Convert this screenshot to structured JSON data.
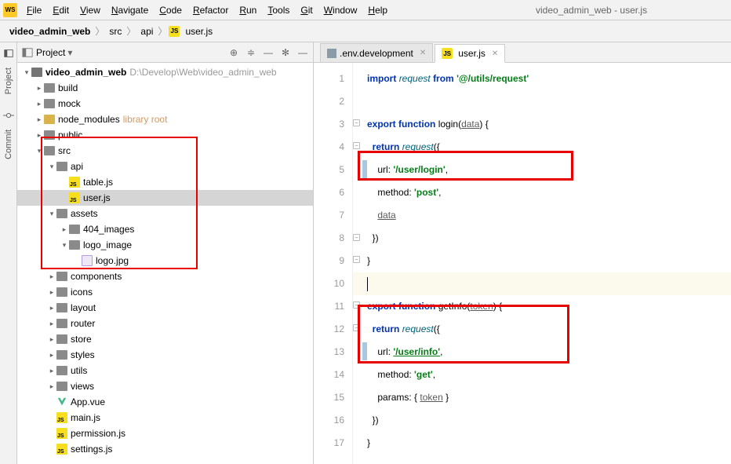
{
  "window": {
    "app": "WS",
    "title": "video_admin_web - user.js"
  },
  "menu": [
    "File",
    "Edit",
    "View",
    "Navigate",
    "Code",
    "Refactor",
    "Run",
    "Tools",
    "Git",
    "Window",
    "Help"
  ],
  "breadcrumb": {
    "project": "video_admin_web",
    "p1": "src",
    "p2": "api",
    "file": "user.js"
  },
  "leftStrip": {
    "project": "Project",
    "commit": "Commit"
  },
  "projectPane": {
    "title": "Project",
    "root": "video_admin_web",
    "rootPath": "D:\\Develop\\Web\\video_admin_web",
    "build": "build",
    "mock": "mock",
    "node_modules": "node_modules",
    "libroot": "library root",
    "public": "public",
    "src": "src",
    "api": "api",
    "tablejs": "table.js",
    "userjs": "user.js",
    "assets": "assets",
    "img404": "404_images",
    "logoimg": "logo_image",
    "logojpg": "logo.jpg",
    "components": "components",
    "icons": "icons",
    "layout": "layout",
    "router": "router",
    "store": "store",
    "styles": "styles",
    "utils": "utils",
    "views": "views",
    "appvue": "App.vue",
    "mainjs": "main.js",
    "permjs": "permission.js",
    "settingsjs": "settings.js"
  },
  "tabs": {
    "env": ".env.development",
    "user": "user.js"
  },
  "lineNumbers": [
    "1",
    "2",
    "3",
    "4",
    "5",
    "6",
    "7",
    "8",
    "9",
    "10",
    "11",
    "12",
    "13",
    "14",
    "15",
    "16",
    "17"
  ],
  "code": {
    "l1": {
      "import": "import",
      "request": "request",
      "from": "from",
      "path": "'@/utils/request'"
    },
    "l3": {
      "export": "export",
      "function": "function",
      "name": "login",
      "param": "data"
    },
    "l4": {
      "return": "return",
      "request": "request"
    },
    "l5": {
      "url": "url:",
      "val": "'/user/login'"
    },
    "l6": {
      "method": "method:",
      "val": "'post'"
    },
    "l7": {
      "data": "data"
    },
    "l11": {
      "export": "export",
      "function": "function",
      "name": "getInfo",
      "param": "token"
    },
    "l12": {
      "return": "return",
      "request": "request"
    },
    "l13": {
      "url": "url:",
      "val": "'/user/info'"
    },
    "l14": {
      "method": "method:",
      "val": "'get'"
    },
    "l15": {
      "params": "params:",
      "token": "token"
    }
  }
}
